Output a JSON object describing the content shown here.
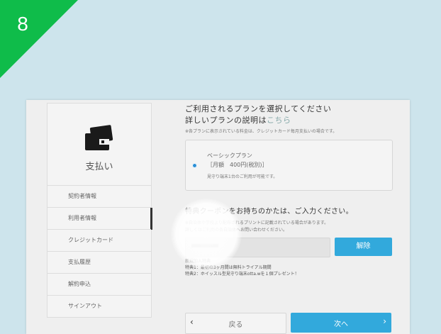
{
  "step": {
    "number": "8",
    "color": "#0fbc4a"
  },
  "sidebar": {
    "title": "支払い",
    "icon": "wallet-icon",
    "items": [
      {
        "label": "契約者情報"
      },
      {
        "label": "利用者情報"
      },
      {
        "label": "クレジットカード"
      },
      {
        "label": "支払履歴"
      },
      {
        "label": "解約申込"
      },
      {
        "label": "サインアウト"
      }
    ]
  },
  "main": {
    "heading": "ご利用されるプランを選択してください",
    "detail_prefix": "詳しいプランの説明は",
    "detail_link": "こちら",
    "price_note": "※各プランに表示されている料金は、クレジットカード毎月支払いの場合です。",
    "plan": {
      "name": "ベーシックプラン",
      "price": "［月額　400円(税別)］",
      "note": "見守り端末1台のご利用が可能です。"
    },
    "coupon": {
      "heading": "特典クーポンをお持ちのかたは、ご入力ください。",
      "note1": "※自治体や学校より配布されるプリントに記載されている場合があります。",
      "note2": "詳しくはご利用の各自治体へお問い合わせください。",
      "clear_label": "解除"
    },
    "benefits": {
      "title": "新規加入特典",
      "item1": "特典1：最初の3ヶ月間は無料トライアル期間",
      "item2": "特典2：ホイッスル型見守り端末otta.wを１個プレゼント！"
    },
    "back_label": "戻る",
    "next_label": "次へ"
  },
  "colors": {
    "accent": "#32a9dc",
    "background": "#cde4ec"
  }
}
